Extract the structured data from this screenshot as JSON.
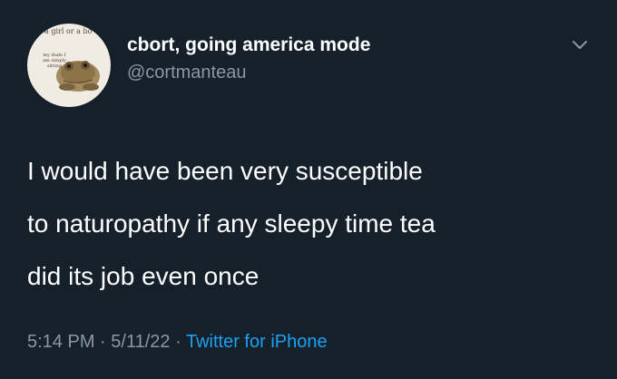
{
  "avatar": {
    "caption_top": "you a girl or a bo",
    "caption_lines": [
      "my dude I",
      "am simply",
      "sitting"
    ]
  },
  "user": {
    "display_name": "cbort, going america mode",
    "handle": "@cortmanteau"
  },
  "tweet": {
    "lines": [
      "I would have been very susceptible",
      "to naturopathy if any sleepy time tea",
      "did its job even once"
    ]
  },
  "meta": {
    "time": "5:14 PM",
    "separator": "·",
    "date": "5/11/22",
    "source": "Twitter for iPhone"
  },
  "icons": {
    "menu": "chevron-down-icon"
  },
  "colors": {
    "background": "#15202b",
    "secondary_text": "#8899a6",
    "link": "#1da1f2"
  }
}
